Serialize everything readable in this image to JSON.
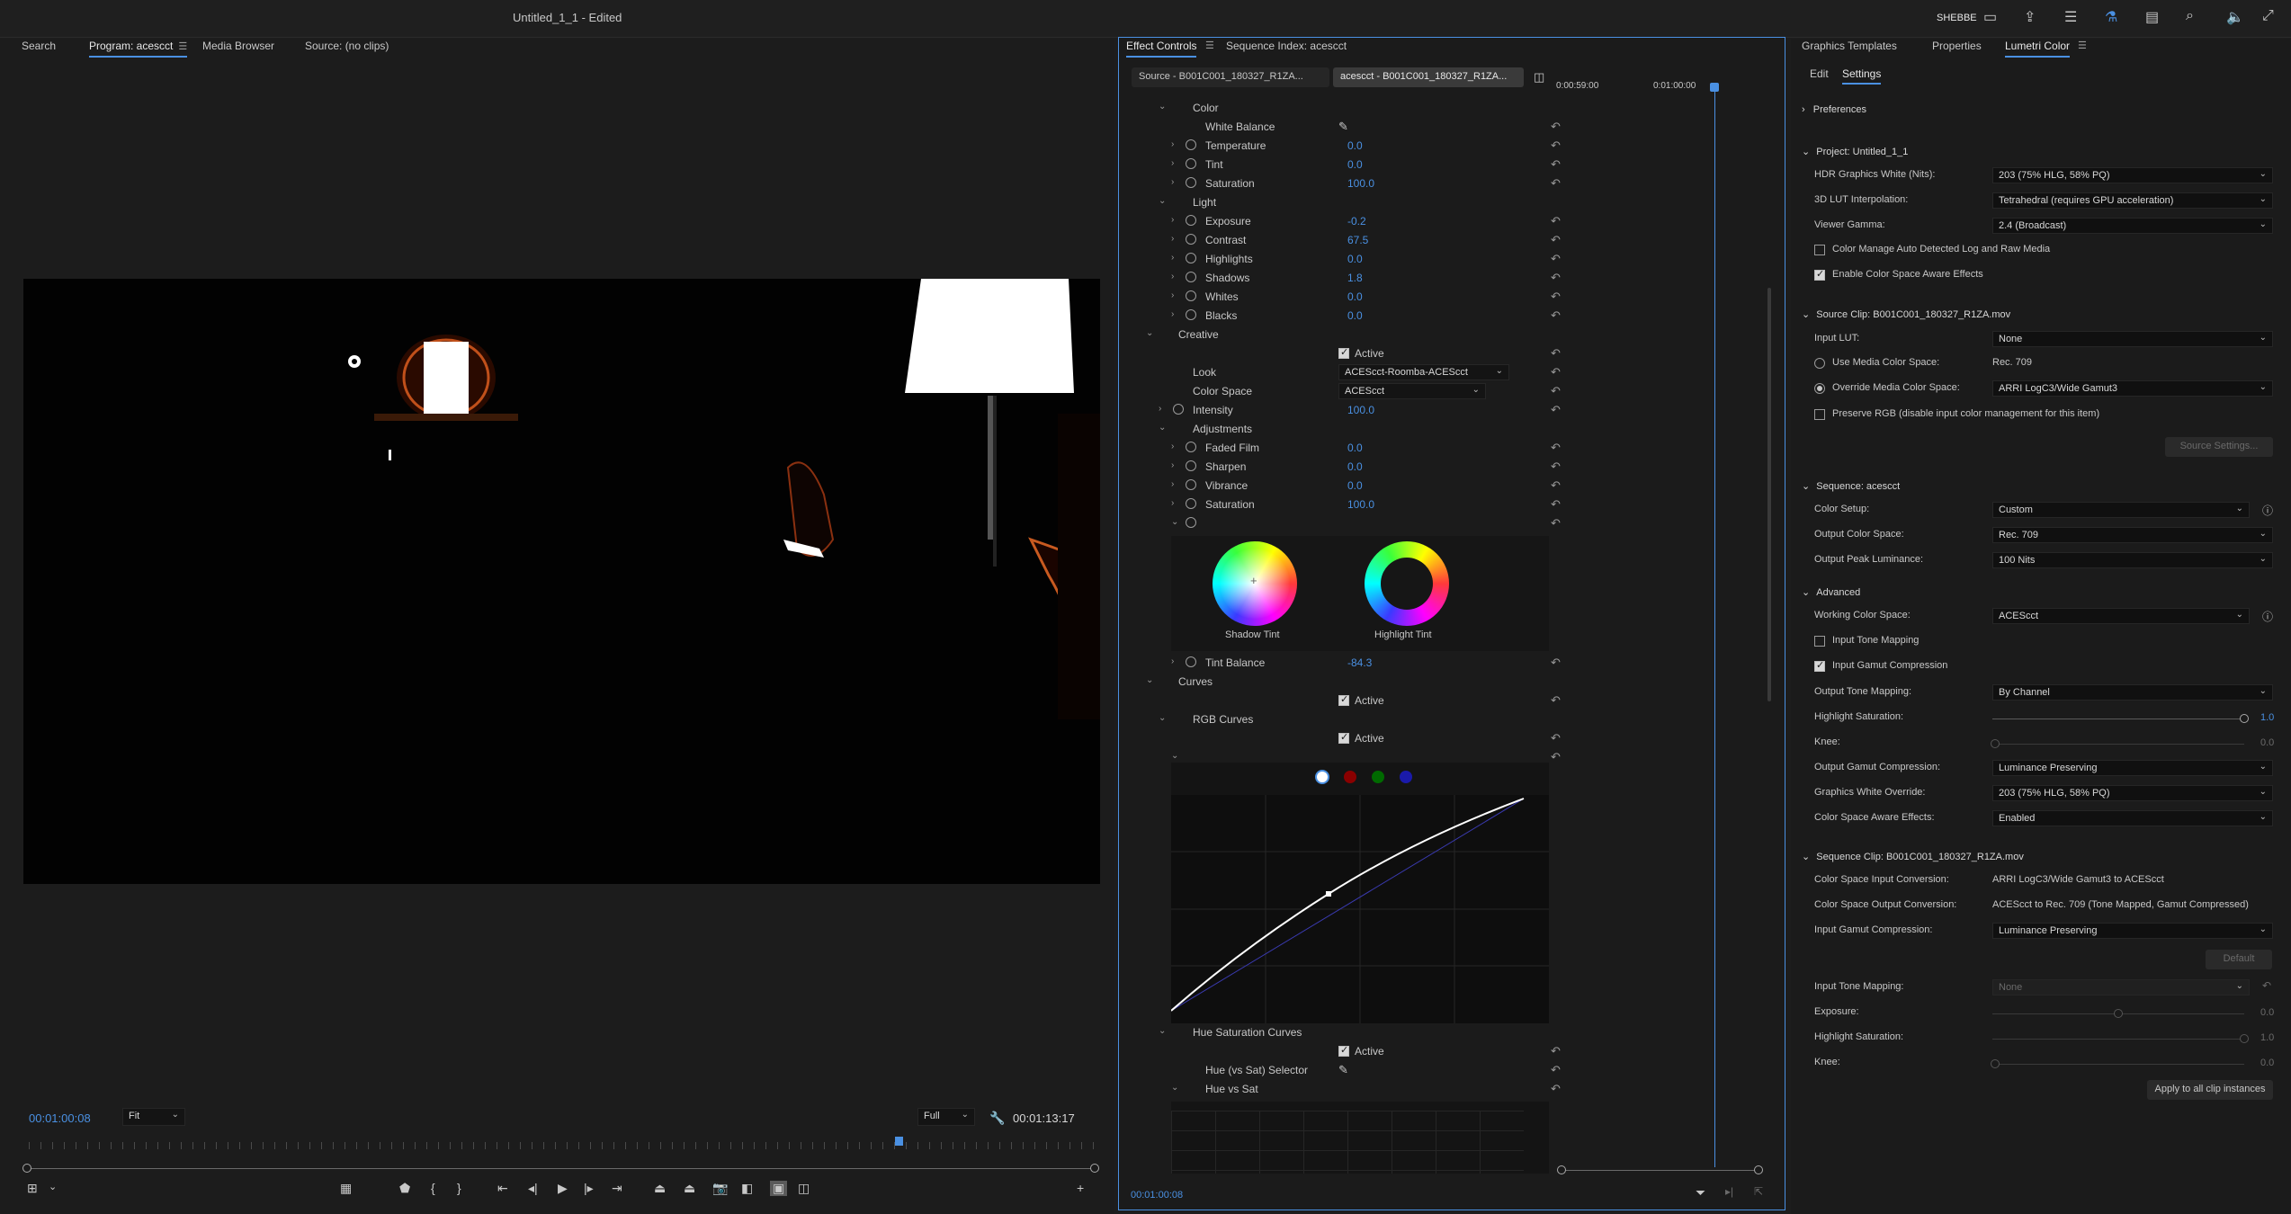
{
  "app": {
    "title": "Untitled_1_1",
    "title_suffix": " - Edited",
    "user": "SHEBBE"
  },
  "left_tabs": [
    "Search",
    "Program: acescct",
    "Media Browser",
    "Source: (no clips)"
  ],
  "program": {
    "timecode_current": "00:01:00:08",
    "zoom": "Fit",
    "resolution": "Full",
    "timecode_end": "00:01:13:17",
    "playhead_fraction": 0.81
  },
  "effect_controls": {
    "tabs": [
      "Effect Controls",
      "Sequence Index: acescct"
    ],
    "source_tab": "Source - B001C001_180327_R1ZA...",
    "clip_tab": "acescct - B001C001_180327_R1ZA...",
    "ruler_start": "0:00:59:00",
    "ruler_mid": "0:01:00:00",
    "timecode": "00:01:00:08",
    "sections": {
      "color": "Color",
      "white_balance": "White Balance",
      "light": "Light",
      "creative": "Creative",
      "active": "Active",
      "look": "Look",
      "color_space": "Color Space",
      "adjustments": "Adjustments",
      "curves": "Curves",
      "rgb_curves": "RGB Curves",
      "hue_sat_curves": "Hue Saturation Curves",
      "hue_sat_selector": "Hue (vs Sat) Selector",
      "hue_vs_sat": "Hue vs Sat"
    },
    "color_params": [
      {
        "label": "Temperature",
        "value": "0.0"
      },
      {
        "label": "Tint",
        "value": "0.0"
      },
      {
        "label": "Saturation",
        "value": "100.0"
      }
    ],
    "light_params": [
      {
        "label": "Exposure",
        "value": "-0.2"
      },
      {
        "label": "Contrast",
        "value": "67.5"
      },
      {
        "label": "Highlights",
        "value": "0.0"
      },
      {
        "label": "Shadows",
        "value": "1.8"
      },
      {
        "label": "Whites",
        "value": "0.0"
      },
      {
        "label": "Blacks",
        "value": "0.0"
      }
    ],
    "look_value": "ACEScct-Roomba-ACEScct",
    "color_space_value": "ACEScct",
    "intensity": {
      "label": "Intensity",
      "value": "100.0"
    },
    "adjust_params": [
      {
        "label": "Faded Film",
        "value": "0.0"
      },
      {
        "label": "Sharpen",
        "value": "0.0"
      },
      {
        "label": "Vibrance",
        "value": "0.0"
      },
      {
        "label": "Saturation",
        "value": "100.0"
      }
    ],
    "shadow_tint": "Shadow Tint",
    "highlight_tint": "Highlight Tint",
    "tint_balance": {
      "label": "Tint Balance",
      "value": "-84.3"
    }
  },
  "right_tabs": [
    "Graphics Templates",
    "Properties",
    "Lumetri Color"
  ],
  "lumetri": {
    "subtabs": [
      "Edit",
      "Settings"
    ],
    "preferences": "Preferences",
    "project": {
      "header": "Project: Untitled_1_1",
      "hdr_white": {
        "label": "HDR Graphics White (Nits):",
        "value": "203 (75% HLG, 58% PQ)"
      },
      "lut_interp": {
        "label": "3D LUT Interpolation:",
        "value": "Tetrahedral (requires GPU acceleration)"
      },
      "viewer_gamma": {
        "label": "Viewer Gamma:",
        "value": "2.4 (Broadcast)"
      },
      "cm_auto": "Color Manage Auto Detected Log and Raw Media",
      "cs_aware": "Enable Color Space Aware Effects"
    },
    "source_clip": {
      "header": "Source Clip: B001C001_180327_R1ZA.mov",
      "input_lut": {
        "label": "Input LUT:",
        "value": "None"
      },
      "use_media": {
        "label": "Use Media Color Space:",
        "value": "Rec. 709"
      },
      "override_media": {
        "label": "Override Media Color Space:",
        "value": "ARRI LogC3/Wide Gamut3"
      },
      "preserve_rgb": "Preserve RGB (disable input color management for this item)",
      "source_settings": "Source Settings..."
    },
    "sequence": {
      "header": "Sequence: acescct",
      "color_setup": {
        "label": "Color Setup:",
        "value": "Custom"
      },
      "output_cs": {
        "label": "Output Color Space:",
        "value": "Rec. 709"
      },
      "peak_lum": {
        "label": "Output Peak Luminance:",
        "value": "100 Nits"
      }
    },
    "advanced": {
      "header": "Advanced",
      "working_cs": {
        "label": "Working Color Space:",
        "value": "ACEScct"
      },
      "input_tone": "Input Tone Mapping",
      "input_gamut": "Input Gamut Compression",
      "output_tone": {
        "label": "Output Tone Mapping:",
        "value": "By Channel"
      },
      "highlight_sat": {
        "label": "Highlight Saturation:",
        "value": "1.0",
        "level": 1.0
      },
      "knee": {
        "label": "Knee:",
        "value": "0.0",
        "level": 0.0
      },
      "output_gamut": {
        "label": "Output Gamut Compression:",
        "value": "Luminance Preserving"
      },
      "gfx_white": {
        "label": "Graphics White Override:",
        "value": "203 (75% HLG, 58% PQ)"
      },
      "cs_aware_effects": {
        "label": "Color Space Aware Effects:",
        "value": "Enabled"
      }
    },
    "seq_clip": {
      "header": "Sequence Clip: B001C001_180327_R1ZA.mov",
      "input_conv": {
        "label": "Color Space Input Conversion:",
        "value": "ARRI LogC3/Wide Gamut3 to ACEScct"
      },
      "output_conv": {
        "label": "Color Space Output Conversion:",
        "value": "ACEScct to Rec. 709 (Tone Mapped, Gamut Compressed)"
      },
      "input_gamut": {
        "label": "Input Gamut Compression:",
        "value": "Luminance Preserving"
      },
      "default_btn": "Default",
      "input_tone": {
        "label": "Input Tone Mapping:",
        "value": "None"
      },
      "exposure": {
        "label": "Exposure:",
        "value": "0.0",
        "level": 0.5
      },
      "hl_sat": {
        "label": "Highlight Saturation:",
        "value": "1.0",
        "level": 1.0
      },
      "knee": {
        "label": "Knee:",
        "value": "0.0",
        "level": 0.0
      },
      "apply_btn": "Apply to all clip instances"
    }
  },
  "colors": {
    "accent": "#4a90e2",
    "background": "#1d1d1d",
    "panel": "#1a1a1a"
  }
}
